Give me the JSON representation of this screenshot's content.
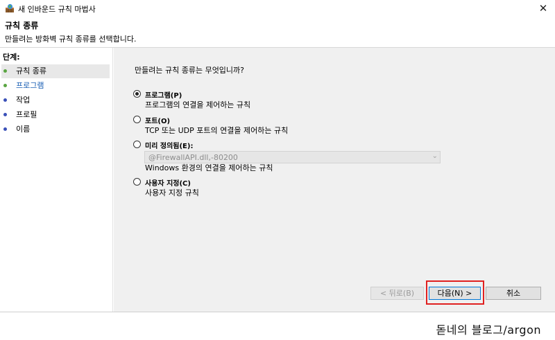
{
  "window": {
    "title": "새 인바운드 규칙 마법사",
    "close_glyph": "✕",
    "app_icon": "firewall-wizard-icon"
  },
  "header": {
    "title": "규칙 종류",
    "subtitle": "만들려는 방화벽 규칙 종류를 선택합니다."
  },
  "sidebar": {
    "heading": "단계:",
    "steps": [
      {
        "label": "규칙 종류",
        "state": "active",
        "dot_color": "#5aa542"
      },
      {
        "label": "프로그램",
        "state": "link",
        "dot_color": "#5aa542"
      },
      {
        "label": "작업",
        "state": "normal",
        "dot_color": "#3a50b8"
      },
      {
        "label": "프로필",
        "state": "normal",
        "dot_color": "#3a50b8"
      },
      {
        "label": "이름",
        "state": "normal",
        "dot_color": "#3a50b8"
      }
    ]
  },
  "main": {
    "question": "만들려는 규칙 종류는 무엇입니까?",
    "options": [
      {
        "label": "프로그램(P)",
        "description": "프로그램의 연결을 제어하는 규칙",
        "checked": true
      },
      {
        "label": "포트(O)",
        "description": "TCP 또는 UDP 포트의 연결을 제어하는 규칙",
        "checked": false
      },
      {
        "label": "미리 정의됨(E):",
        "description": "Windows 환경의 연결을 제어하는 규칙",
        "checked": false
      },
      {
        "label": "사용자 지정(C)",
        "description": "사용자 지정 규칙",
        "checked": false
      }
    ],
    "predefined_select": {
      "value": "@FirewallAPI.dll,-80200",
      "enabled": false
    }
  },
  "buttons": {
    "back": "< 뒤로(B)",
    "next": "다음(N) >",
    "cancel": "취소"
  },
  "watermark": "돋네의 블로그/argon",
  "colors": {
    "highlight": "#e02020",
    "link": "#1a5fb4",
    "panel_bg": "#f0f0f0"
  }
}
